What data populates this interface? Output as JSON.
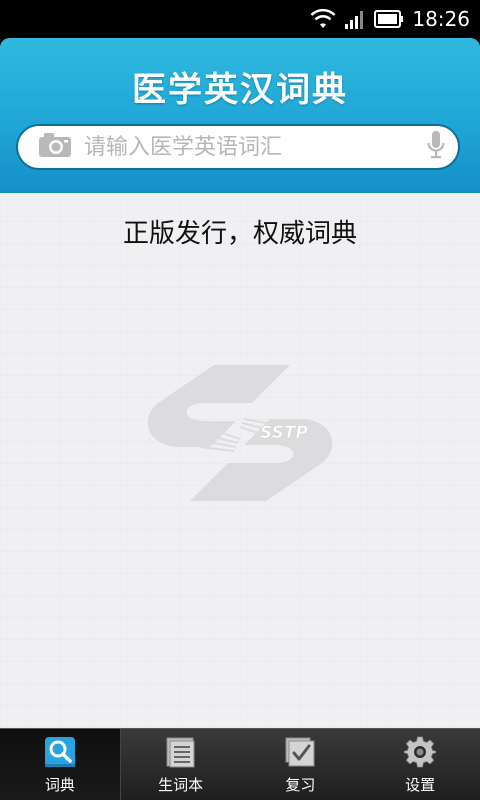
{
  "status_bar": {
    "time": "18:26",
    "icons": [
      "wifi-icon",
      "signal-icon",
      "battery-icon"
    ]
  },
  "header": {
    "title": "医学英汉词典",
    "search": {
      "placeholder": "请输入医学英语词汇",
      "value": "",
      "left_icon": "camera-icon",
      "right_icon": "microphone-icon"
    }
  },
  "main": {
    "tagline": "正版发行，权威词典",
    "watermark_text": "SSTP"
  },
  "tabbar": {
    "tabs": [
      {
        "label": "词典",
        "icon": "search-icon",
        "active": true
      },
      {
        "label": "生词本",
        "icon": "notebook-icon",
        "active": false
      },
      {
        "label": "复习",
        "icon": "checkbox-icon",
        "active": false
      },
      {
        "label": "设置",
        "icon": "gear-icon",
        "active": false
      }
    ]
  },
  "colors": {
    "header_top": "#2fb9df",
    "header_bottom": "#168fc8",
    "search_border": "#0e6f9e",
    "background": "#f0eff2",
    "tabbar": "#2a2a2a"
  }
}
